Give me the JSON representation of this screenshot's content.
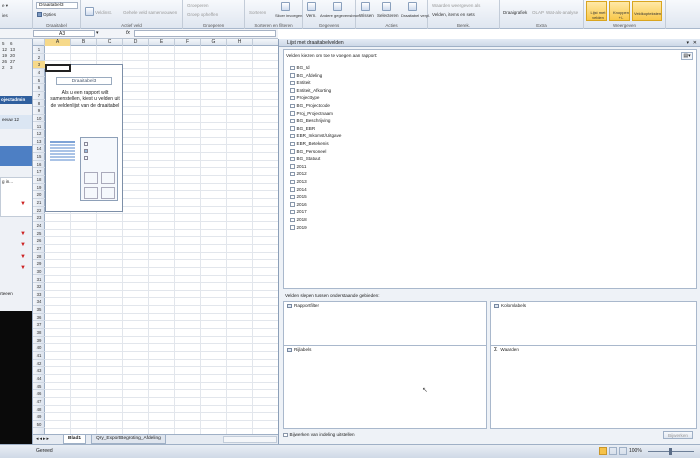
{
  "ribbon": {
    "pivottable_name": "Draaitabel3",
    "options_label": "Opties",
    "groups": [
      "Draaitabel",
      "Actief veld",
      "Groeperen",
      "Sorteren en filteren",
      "Gegevens",
      "Acties",
      "Berek.",
      "Extra",
      "Weergeven"
    ],
    "active_field": "Veldinst.",
    "expand_label": "Gehele veld samenvouwen",
    "group_selection": "Groeperen",
    "ungroup": "Groep opheffen",
    "sort": "Sorteren",
    "slicer": "Slicer invoegen",
    "refresh": "Vern.",
    "change_source": "Andere gegevensbron",
    "clear": "Wissen",
    "select": "Selecteren",
    "move": "Draaitabel verpl.",
    "summarize": "Waarden weergeven als",
    "fields_items": "Velden, items en sets",
    "pivotchart": "Draaigrafiek",
    "olap": "OLAP",
    "whatif": "Wat-als-analyse",
    "fieldlist_btn": "Lijst met velden",
    "buttons_btn": "Knoppen +/-",
    "headers_btn": "Veldkopteksten"
  },
  "formula_bar": {
    "name_box": "A3",
    "fx": "fx",
    "value": ""
  },
  "left_strip": {
    "dates_a": [
      "5",
      "12",
      "19",
      "26",
      "2"
    ],
    "dates_b": [
      "6",
      "13",
      "20",
      "27",
      "3"
    ],
    "label1": "ojectadmin",
    "label2": "eeuw 12",
    "label3": "g in...",
    "label4": "rteeen"
  },
  "grid": {
    "columns": [
      "A",
      "B",
      "C",
      "D",
      "E",
      "F",
      "G",
      "H"
    ],
    "rows": [
      "1",
      "2",
      "3",
      "4",
      "5",
      "6",
      "7",
      "8",
      "9",
      "10",
      "11",
      "12",
      "13",
      "14",
      "15",
      "16",
      "17",
      "18",
      "19",
      "20",
      "21",
      "22",
      "23",
      "24",
      "25",
      "26",
      "27",
      "28",
      "29",
      "30",
      "31",
      "32",
      "33",
      "34",
      "35",
      "36",
      "37",
      "38",
      "39",
      "40",
      "41",
      "42",
      "43",
      "44",
      "45",
      "46",
      "47",
      "48",
      "49",
      "50"
    ],
    "pivot_title": "Draaitabel3",
    "pivot_text": "Als u een rapport wilt samenstellen, kiest u velden uit de veldenlijst van de draaitabel"
  },
  "sheet_tabs": {
    "tab1": "Blad1",
    "tab2": "Qry_ExportBegroting_Afdeling"
  },
  "status": {
    "ready": "Gereed",
    "zoom": "100%"
  },
  "field_list": {
    "title": "Lijst met draaitabelvelden",
    "choose_label": "Velden kiezen om toe te voegen aan rapport:",
    "fields": [
      "BG_Id",
      "BG_Afdeling",
      "Entiteit",
      "Entiteit_Afkorting",
      "Projecttype",
      "BG_Projectcode",
      "Proj_Projectnaam",
      "BG_Beschrijving",
      "BG_EBR",
      "EBR_Inkomst/Uitgave",
      "EBR_Betekenis",
      "BG_Personeel",
      "BG_Statuut",
      "2011",
      "2012",
      "2013",
      "2014",
      "2015",
      "2016",
      "2017",
      "2018",
      "2019"
    ],
    "drag_label": "Velden slepen tussen onderstaande gebieden:",
    "area_report_filter": "Rapportfilter",
    "area_column_labels": "Kolomlabels",
    "area_row_labels": "Rijlabels",
    "area_values": "Waarden",
    "defer_label": "Bijwerken van indeling uitstellen",
    "update_button": "Bijwerken"
  }
}
